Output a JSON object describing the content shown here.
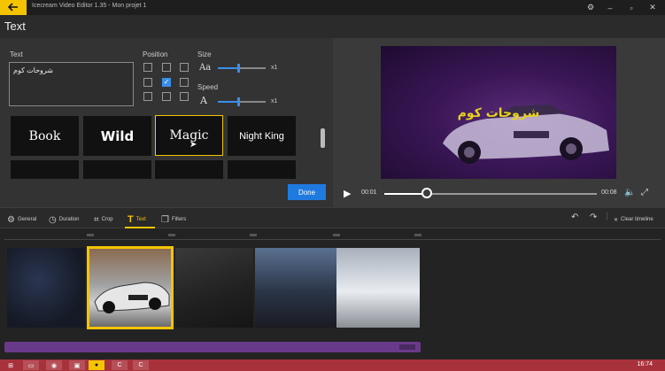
{
  "window": {
    "title": "Icecream Video Editor 1.35 - Mon projet 1",
    "controls": [
      "gear-icon",
      "minimize-icon",
      "maximize-icon",
      "close-icon"
    ]
  },
  "page": {
    "title": "Text"
  },
  "text_panel": {
    "text_label": "Text",
    "text_value": "شروحات كوم",
    "position_label": "Position",
    "position_selected": "middle-center",
    "size_label": "Size",
    "size_multiplier": "x1",
    "size_level": 0.43,
    "speed_label": "Speed",
    "speed_multiplier": "x1",
    "speed_level": 0.43,
    "styles": [
      {
        "label": "Book"
      },
      {
        "label": "Wild"
      },
      {
        "label": "Magic"
      },
      {
        "label": "Night King"
      }
    ],
    "selected_style": "Magic",
    "done_label": "Done"
  },
  "preview": {
    "overlay_text": "شروحات كوم",
    "current_time": "00:01",
    "total_time": "00:08",
    "progress": 0.2
  },
  "toolbar": {
    "tools": [
      {
        "label": "General",
        "icon": "gear-icon"
      },
      {
        "label": "Duration",
        "icon": "clock-icon"
      },
      {
        "label": "Crop",
        "icon": "crop-icon"
      },
      {
        "label": "Text",
        "icon": "text-icon"
      },
      {
        "label": "Filters",
        "icon": "filters-icon"
      }
    ],
    "active_tool": "Text",
    "clear_timeline_label": "Clear timeline"
  },
  "timeline": {
    "clip_count": 5,
    "selected_clip": 1
  },
  "taskbar": {
    "clock": "16:74"
  },
  "colors": {
    "accent": "#f5c400",
    "primary": "#1f7ae0",
    "overlay_text": "#e8d21a",
    "taskbar": "#a8323c"
  }
}
